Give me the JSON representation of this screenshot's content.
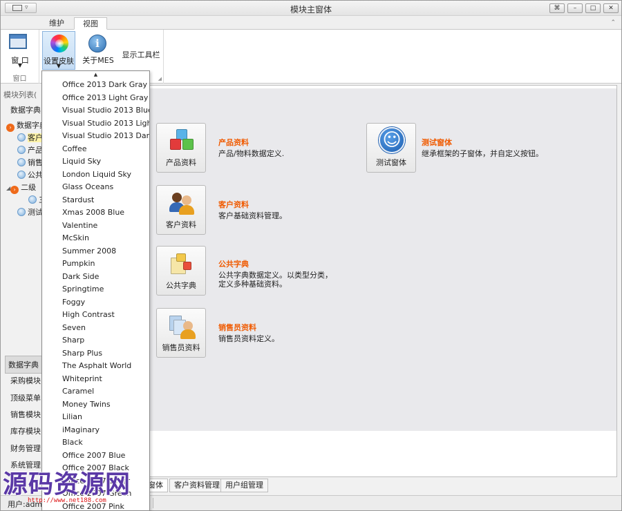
{
  "window": {
    "title": "模块主窗体",
    "controls": [
      "⌘",
      "–",
      "□",
      "✕"
    ]
  },
  "ribbon": {
    "tabs": [
      "维护",
      "视图"
    ],
    "active_tab": "视图",
    "groups": {
      "window_group_label": "窗口",
      "window_button": "窗 口",
      "skin_button": "设置皮肤",
      "about_button": "关于MES",
      "toolbar_button": "显示工具栏"
    }
  },
  "sidebar": {
    "header": "模块列表(",
    "tree": [
      {
        "label": "数据字典",
        "icon": "none",
        "level": 0
      },
      {
        "label": "数据字典",
        "icon": "orange",
        "level": 0
      },
      {
        "label": "客户",
        "icon": "blue",
        "level": 1,
        "selected": true
      },
      {
        "label": "产品",
        "icon": "blue",
        "level": 1
      },
      {
        "label": "销售",
        "icon": "blue",
        "level": 1
      },
      {
        "label": "公共",
        "icon": "blue",
        "level": 1
      },
      {
        "label": "二级",
        "icon": "orange",
        "level": 0
      },
      {
        "label": "三",
        "icon": "blue",
        "level": 2
      },
      {
        "label": "测试",
        "icon": "blue",
        "level": 1
      }
    ],
    "nav_tabs": [
      "数据字典",
      "采购模块",
      "顶级菜单I",
      "销售模块",
      "库存模块",
      "财务管理",
      "系统管理"
    ]
  },
  "modules": [
    {
      "button": "产品资料",
      "title": "产品资料",
      "desc": [
        "产品/物料数据定义."
      ],
      "icon": "cubes-icon"
    },
    {
      "button": "客户资料",
      "title": "客户资料",
      "desc": [
        "客户基础资料管理。"
      ],
      "icon": "customers-icon"
    },
    {
      "button": "公共字典",
      "title": "公共字典",
      "desc": [
        "公共字典数据定义。以类型分类，",
        "定义多种基础资料。"
      ],
      "icon": "dictionary-icon"
    },
    {
      "button": "销售员资料",
      "title": "销售员资料",
      "desc": [
        "销售员资料定义。"
      ],
      "icon": "salesman-icon"
    },
    {
      "button": "测试窗体",
      "title": "测试窗体",
      "desc": [
        "继承框架的子窗体，并自定义按钮。"
      ],
      "icon": "accessibility-icon"
    }
  ],
  "bottom_tabs": [
    "窗体",
    "客户资料管理",
    "用户组管理"
  ],
  "status": {
    "user": "用户:admi"
  },
  "skins_menu": [
    "Office 2013 Dark Gray",
    "Office 2013 Light Gray",
    "Visual Studio 2013 Blue",
    "Visual Studio 2013 Light",
    "Visual Studio 2013 Dark",
    "Coffee",
    "Liquid Sky",
    "London Liquid Sky",
    "Glass Oceans",
    "Stardust",
    "Xmas 2008 Blue",
    "Valentine",
    "McSkin",
    "Summer 2008",
    "Pumpkin",
    "Dark Side",
    "Springtime",
    "Foggy",
    "High Contrast",
    "Seven",
    "Sharp",
    "Sharp Plus",
    "The Asphalt World",
    "Whiteprint",
    "Caramel",
    "Money Twins",
    "Lilian",
    "iMaginary",
    "Black",
    "Office 2007 Blue",
    "Office 2007 Black",
    "Office 2007 Silver",
    "Office 2007 Green",
    "Office 2007 Pink"
  ],
  "watermark": {
    "text": "源码资源网",
    "url": "http://www.net188.com"
  },
  "colors": {
    "accent_orange": "#f05a00",
    "selection_yellow": "#fdf3a8",
    "watermark_purple": "#5a38a6"
  }
}
